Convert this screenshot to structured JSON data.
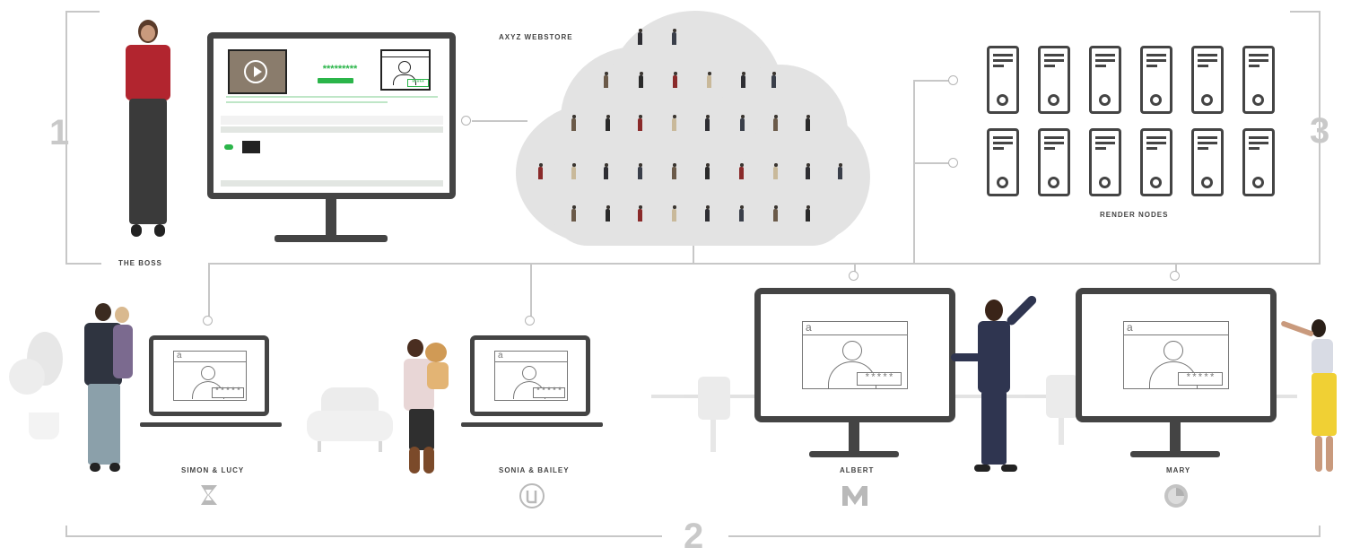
{
  "section_numbers": {
    "one": "1",
    "two": "2",
    "three": "3"
  },
  "webstore": {
    "label": "AXYZ WEBSTORE"
  },
  "render_nodes": {
    "label": "RENDER NODES",
    "count": 12
  },
  "boss": {
    "label": "THE BOSS",
    "screen_password": "*********",
    "screen_pin": "*****"
  },
  "users": [
    {
      "label": "SIMON & LUCY",
      "password": "*****",
      "app_icon": "3ds-max-icon"
    },
    {
      "label": "SONIA & BAILEY",
      "password": "*****",
      "app_icon": "unreal-engine-icon"
    },
    {
      "label": "ALBERT",
      "password": "*****",
      "app_icon": "maya-icon"
    },
    {
      "label": "MARY",
      "password": "*****",
      "app_icon": "cinema4d-icon"
    }
  ],
  "login_letter": "a",
  "colors": {
    "accent_green": "#2bb54a",
    "frame": "#444444",
    "line": "#c7c7c7",
    "cloud": "#e3e3e3",
    "number": "#c9c9c9"
  }
}
